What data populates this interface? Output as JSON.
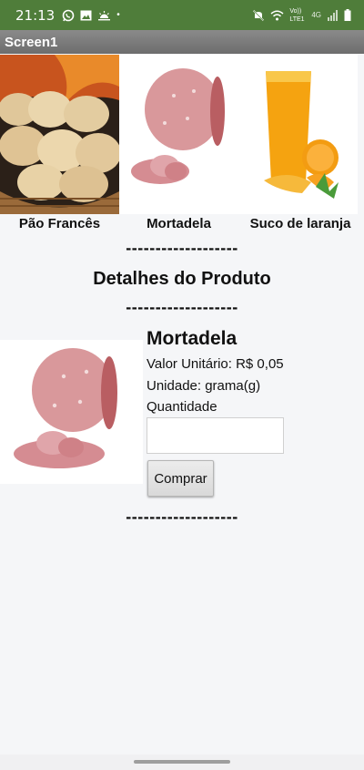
{
  "status_bar": {
    "time": "21:13",
    "dot": "•",
    "volte_label": "Vo)) LTE1",
    "network_label": "4G",
    "icons": [
      "whatsapp-icon",
      "image-icon",
      "weather-icon",
      "mute-icon",
      "wifi-icon",
      "signal-icon",
      "battery-icon"
    ]
  },
  "app": {
    "title": "Screen1",
    "header_color": "#4f7d3a"
  },
  "products": [
    {
      "label": "Pão Francês",
      "image": "bread-rolls-basket"
    },
    {
      "label": "Mortadela",
      "image": "mortadella"
    },
    {
      "label": "Suco de laranja",
      "image": "orange-juice"
    }
  ],
  "divider_text": "-------------------",
  "section_title": "Detalhes do Produto",
  "detail": {
    "name": "Mortadela",
    "unit_price": "Valor Unitário: R$ 0,05",
    "unit": "Unidade: grama(g)",
    "quantity_label": "Quantidade",
    "quantity_value": "",
    "buy_label": "Comprar"
  }
}
